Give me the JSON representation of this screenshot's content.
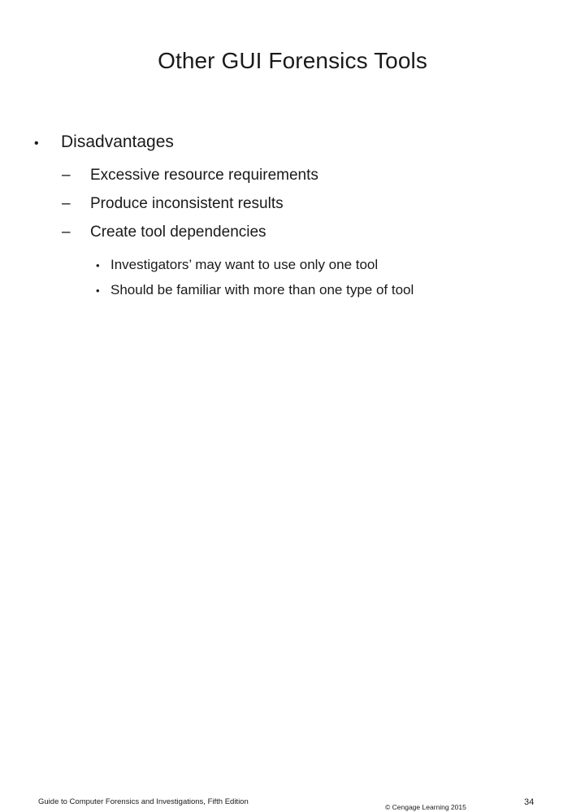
{
  "slide": {
    "title": "Other GUI Forensics Tools",
    "bullets": [
      {
        "level": 1,
        "marker": "•",
        "text": "Disadvantages"
      },
      {
        "level": 2,
        "marker": "–",
        "text": "Excessive resource requirements"
      },
      {
        "level": 2,
        "marker": "–",
        "text": "Produce inconsistent results"
      },
      {
        "level": 2,
        "marker": "–",
        "text": "Create tool dependencies"
      },
      {
        "level": 3,
        "marker": "•",
        "text": "Investigators’ may want to use only one tool"
      },
      {
        "level": 3,
        "marker": "•",
        "text": "Should be familiar with more than one type of tool"
      }
    ]
  },
  "footer": {
    "source": "Guide to Computer Forensics and Investigations, Fifth Edition",
    "copyright": "© Cengage Learning  2015",
    "page_number": "34"
  },
  "colors": {
    "background": "#ffffff",
    "text": "#1a1a1a"
  }
}
